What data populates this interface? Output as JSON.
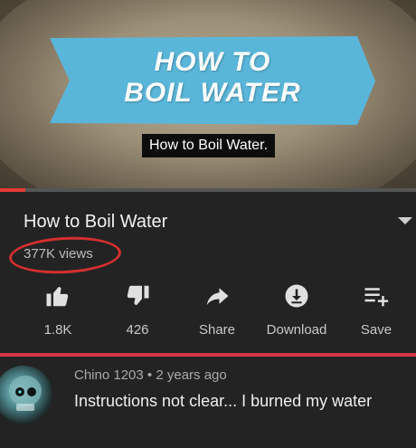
{
  "video": {
    "banner_line1": "HOW TO",
    "banner_line2": "BOIL WATER",
    "caption": "How to Boil Water.",
    "progress_fraction": 0.06,
    "accent": "#e53935",
    "banner_color": "#5ab6d9"
  },
  "details": {
    "title": "How to Boil Water",
    "views": "377K views",
    "expand_icon": "chevron-down-icon"
  },
  "actions": [
    {
      "icon": "thumbs-up-icon",
      "label": "1.8K"
    },
    {
      "icon": "thumbs-down-icon",
      "label": "426"
    },
    {
      "icon": "share-icon",
      "label": "Share"
    },
    {
      "icon": "download-icon",
      "label": "Download"
    },
    {
      "icon": "save-playlist-icon",
      "label": "Save"
    }
  ],
  "comment": {
    "author": "Chino 1203",
    "separator": "•",
    "time": "2 years ago",
    "text": "Instructions not clear... I burned my water",
    "avatar_icon": "skull-avatar-icon"
  }
}
